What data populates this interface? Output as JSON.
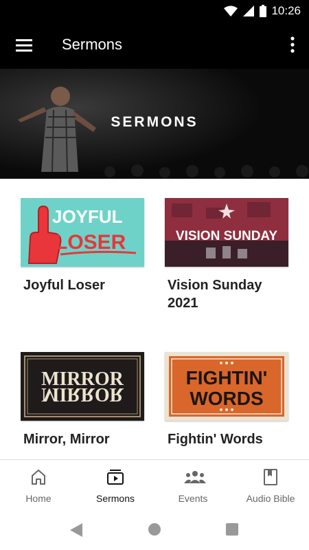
{
  "status_bar": {
    "time": "10:26"
  },
  "app_bar": {
    "title": "Sermons"
  },
  "banner": {
    "title": "SERMONS"
  },
  "sermons": [
    {
      "title": "Joyful Loser",
      "art_top": "JOYFUL",
      "art_bottom": "LOSER"
    },
    {
      "title": "Vision Sunday 2021",
      "art_text": "VISION SUNDAY"
    },
    {
      "title": "Mirror, Mirror",
      "art_text": "MIRROR"
    },
    {
      "title": "Fightin' Words",
      "art_top": "FIGHTIN'",
      "art_bottom": "WORDS"
    }
  ],
  "bottom_nav": [
    {
      "label": "Home",
      "icon": "home-icon"
    },
    {
      "label": "Sermons",
      "icon": "video-library-icon",
      "active": true
    },
    {
      "label": "Events",
      "icon": "group-icon"
    },
    {
      "label": "Audio Bible",
      "icon": "book-icon"
    }
  ],
  "colors": {
    "header_bg": "#000000",
    "joyful_bg": "#6fd2c8",
    "joyful_red": "#e8363a",
    "vision_bg": "#8e2e3e",
    "mirror_bg": "#1f1b1a",
    "fightin_bg": "#d9662a"
  }
}
